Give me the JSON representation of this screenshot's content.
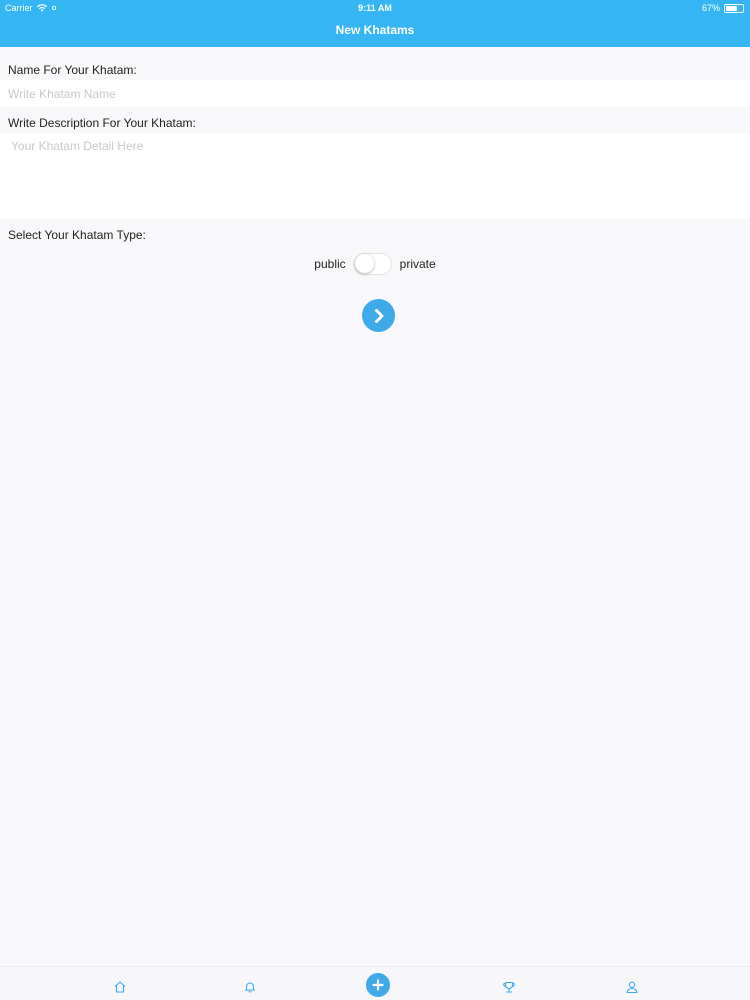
{
  "status_bar": {
    "carrier": "Carrier",
    "time": "9:11 AM",
    "battery": "67%",
    "battery_level": 0.67
  },
  "header": {
    "title": "New Khatams",
    "color": "#36b5f5"
  },
  "form": {
    "name_label": "Name For Your Khatam:",
    "name_placeholder": "Write Khatam Name",
    "name_value": "",
    "description_label": "Write Description For Your Khatam:",
    "description_placeholder": "Your Khatam Detail Here",
    "description_value": "",
    "type_label": "Select Your Khatam Type:",
    "type_option_left": "public",
    "type_option_right": "private",
    "type_private_selected": false
  },
  "next_button": {
    "icon": "chevron-right-icon",
    "color": "#3fa9ea"
  },
  "tab_bar": {
    "accent_color": "#3fa9ea",
    "items": [
      {
        "icon": "home-icon"
      },
      {
        "icon": "bell-icon"
      },
      {
        "icon": "plus-icon"
      },
      {
        "icon": "trophy-icon"
      },
      {
        "icon": "person-icon"
      }
    ]
  }
}
